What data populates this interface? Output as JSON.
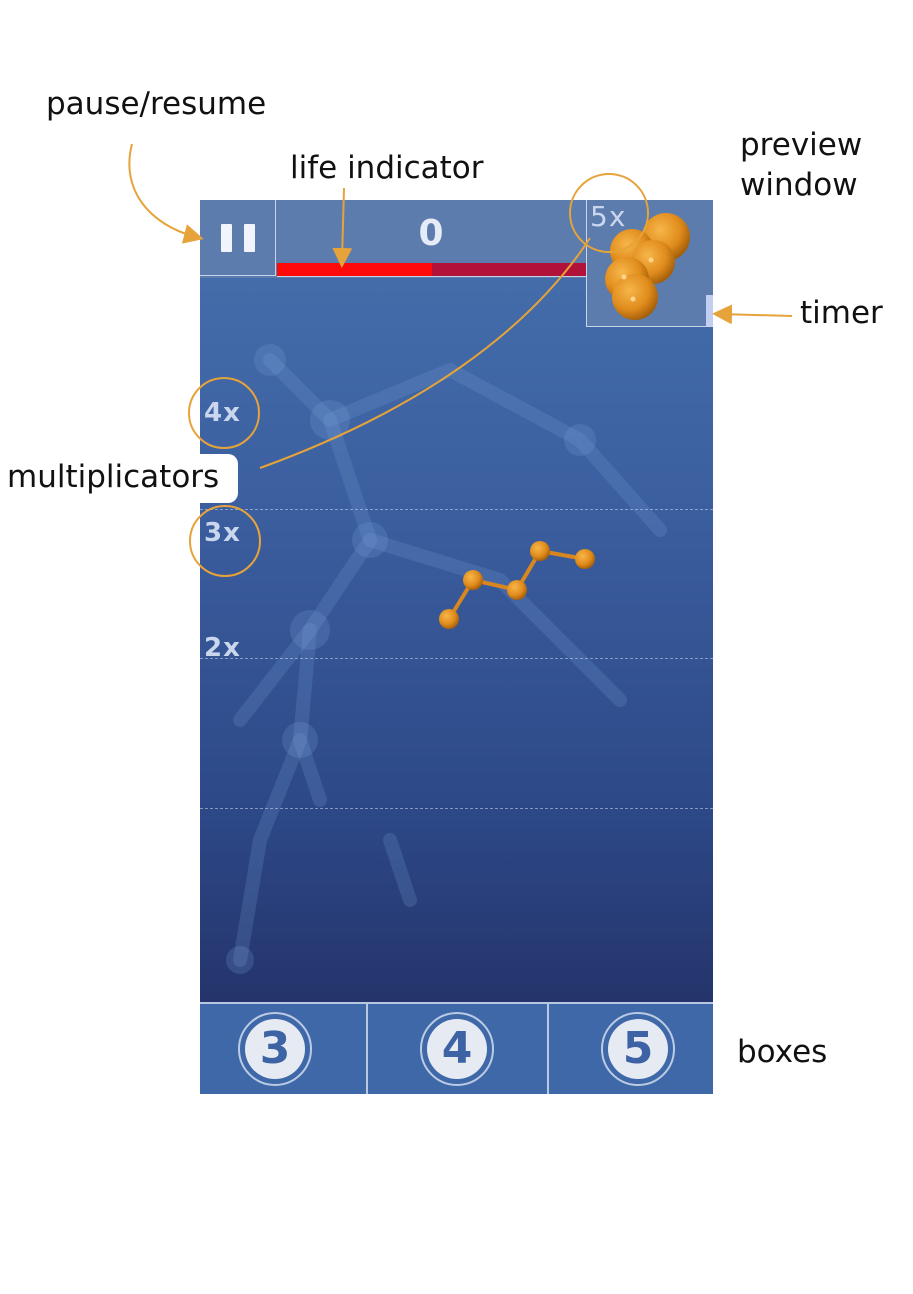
{
  "annotations": {
    "pause_resume": "pause/resume",
    "life_indicator": "life indicator",
    "preview_window": "preview\nwindow",
    "timer": "timer",
    "multiplicators": "multiplicators",
    "boxes": "boxes"
  },
  "hud": {
    "score": "0",
    "life_fraction": 0.5,
    "preview_multiplier": "5x",
    "timer_fraction": 0.25
  },
  "multipliers": [
    "4x",
    "3x",
    "2x"
  ],
  "boxes": [
    {
      "label": "3"
    },
    {
      "label": "4"
    },
    {
      "label": "5"
    }
  ],
  "colors": {
    "accent": "#e6a33a",
    "life_full": "#ff0a0a",
    "life_empty": "#b0123a",
    "atom": "#e08c1c"
  },
  "icons": {
    "pause": "pause-icon"
  }
}
